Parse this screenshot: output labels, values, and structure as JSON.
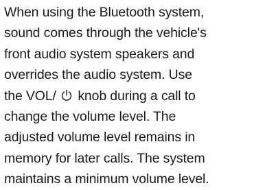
{
  "document": {
    "lines": [
      "When using the Bluetooth system,",
      "sound comes through the vehicle's",
      "front audio system speakers and",
      "overrides the audio system. Use",
      {
        "before": "the VOL/",
        "icon": "power-icon",
        "after": "knob during a call to"
      },
      "change the volume level. The",
      "adjusted volume level remains in",
      "memory for later calls. The system",
      "maintains a minimum volume level."
    ]
  }
}
